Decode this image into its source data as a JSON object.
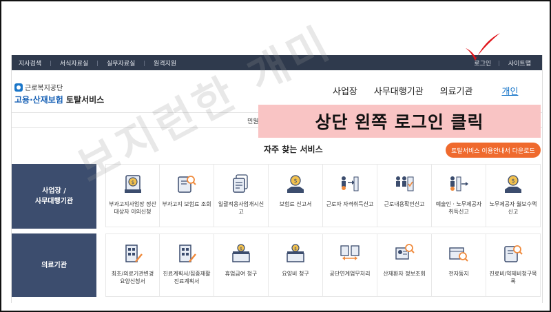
{
  "topbar": {
    "left_links": [
      "지사검색",
      "서식자료실",
      "실무자료실",
      "원격지원"
    ],
    "right_links": [
      "로그인",
      "사이트맵"
    ]
  },
  "logo": {
    "org": "근로복지공단",
    "brand_main": "고용·산재보험",
    "brand_sub": "토탈서비스"
  },
  "nav": {
    "items": [
      "사업장",
      "사무대행기관",
      "의료기관",
      "개인"
    ],
    "active": "개인"
  },
  "subnav": {
    "text": "민원"
  },
  "banner": {
    "text": "상단 왼쪽 로그인 클릭"
  },
  "services": {
    "title": "자주 찾는 서비스",
    "guide_button": "토탈서비스 이용안내서 다운로드",
    "categories": [
      {
        "label_line1": "사업장 /",
        "label_line2": "사무대행기관",
        "items": [
          {
            "label": "부과고지사업장 정산대상자 이의신청",
            "icon": "money-document-icon"
          },
          {
            "label": "부과고지 보험료 조회",
            "icon": "document-search-icon"
          },
          {
            "label": "일괄적용사업개시신고",
            "icon": "documents-icon"
          },
          {
            "label": "보험료 신고서",
            "icon": "money-hand-icon"
          },
          {
            "label": "근로자 자격취득신고",
            "icon": "workers-in-icon"
          },
          {
            "label": "근로내용확인신고",
            "icon": "workers-check-icon"
          },
          {
            "label": "예술인 · 노무제공자 취득신고",
            "icon": "workers-out-icon"
          },
          {
            "label": "노무제공자 월보수액 신고",
            "icon": "money-hand-icon"
          }
        ]
      },
      {
        "label_line1": "의료기관",
        "label_line2": "",
        "items": [
          {
            "label": "최초/의료기관변경 요양신청서",
            "icon": "hospital-pen-icon"
          },
          {
            "label": "진료계획서/집중재활진료계획서",
            "icon": "hospital-pen-icon"
          },
          {
            "label": "휴업급여 청구",
            "icon": "money-box-icon"
          },
          {
            "label": "요양비 청구",
            "icon": "money-box-icon"
          },
          {
            "label": "공단연계업무처리",
            "icon": "files-link-icon"
          },
          {
            "label": "산재환자 정보조회",
            "icon": "patient-search-icon"
          },
          {
            "label": "전자동지",
            "icon": "box-search-icon"
          },
          {
            "label": "진료비/약제비청구목록",
            "icon": "document-search-icon"
          }
        ]
      }
    ]
  },
  "watermark": "보지런한 개미",
  "colors": {
    "topbar": "#2f3a4d",
    "brand_blue": "#1660b5",
    "category_bg": "#3c4d6e",
    "guide_button": "#ef6a2e",
    "banner": "#f9c4c4",
    "check": "#e0141a"
  }
}
